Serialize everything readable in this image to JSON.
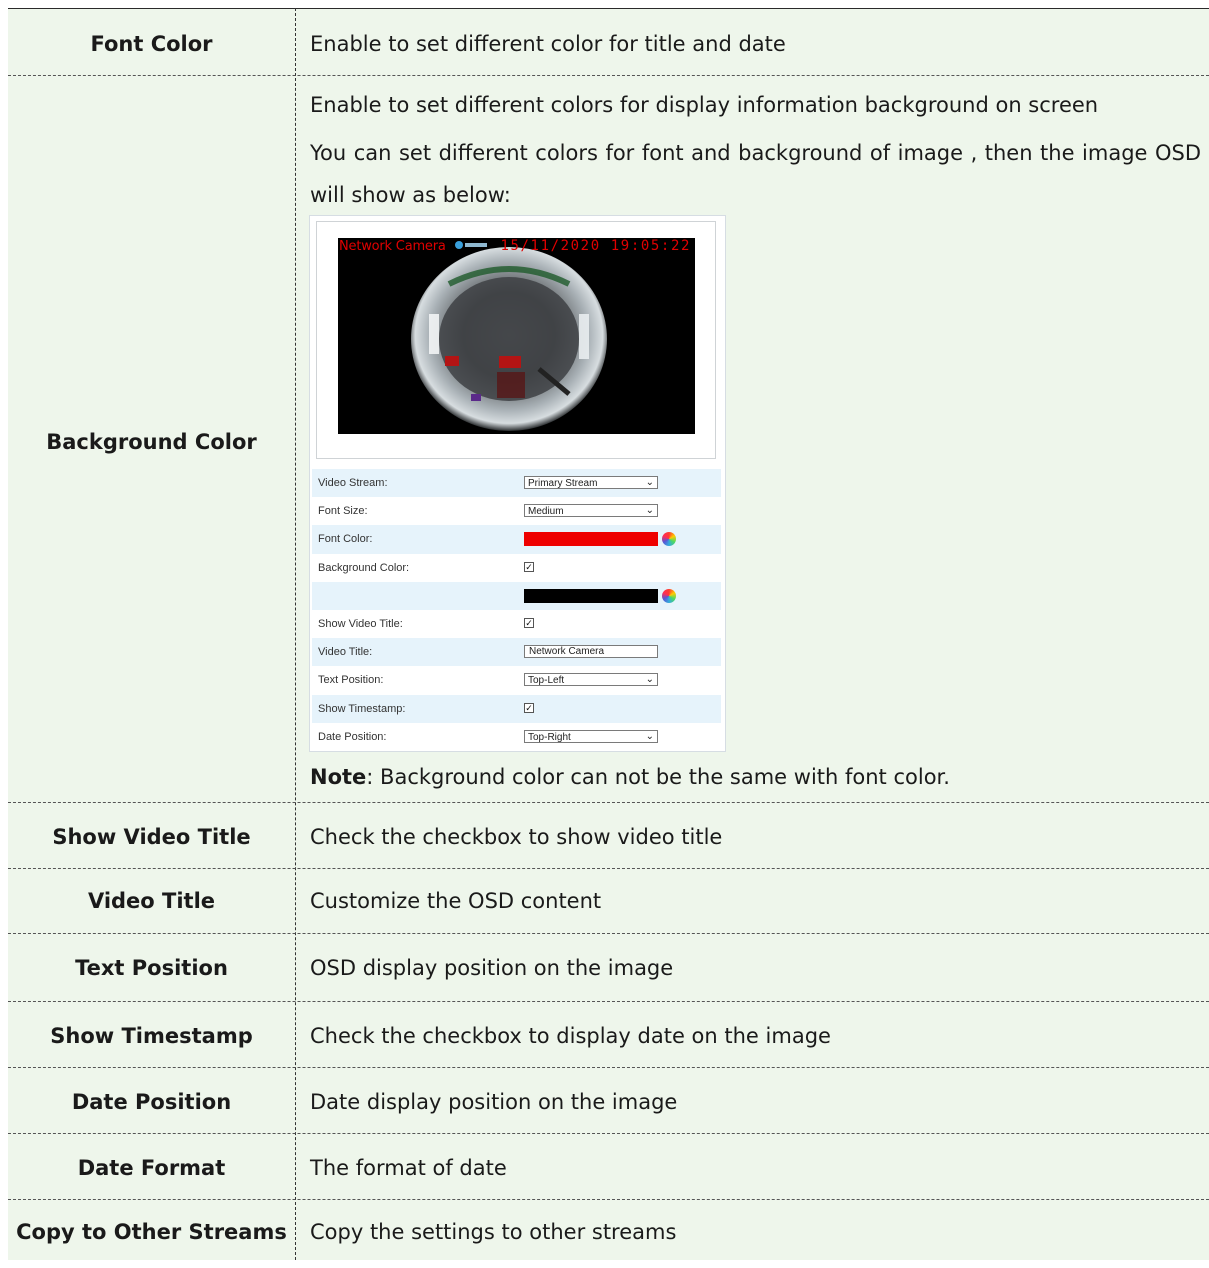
{
  "rows": [
    {
      "label": "Font Color",
      "desc": "Enable to set different color for title and date"
    },
    {
      "label": "Background Color",
      "desc_line1": "Enable to set different colors for display information background on screen",
      "desc_line2": "You can set different colors for font and background of image , then the image OSD will show as below:",
      "note_bold": "Note",
      "note_text": ": Background color can not be the same with font color."
    },
    {
      "label": "Show Video Title",
      "desc": "Check the checkbox to show video title"
    },
    {
      "label": "Video Title",
      "desc": "Customize the OSD content"
    },
    {
      "label": "Text Position",
      "desc": "OSD display position on the image"
    },
    {
      "label": "Show Timestamp",
      "desc": "Check the checkbox to display date on the image"
    },
    {
      "label": "Date Position",
      "desc": "Date display position on the image"
    },
    {
      "label": "Date Format",
      "desc": "The format of date"
    },
    {
      "label": "Copy to Other Streams",
      "desc": "Copy the settings to other streams"
    }
  ],
  "screenshot": {
    "osd_title": "Network Camera",
    "osd_date": "15/11/2020  19:05:22",
    "font_color": "#ee0000",
    "background_color": "#000000",
    "form": {
      "video_stream_label": "Video Stream:",
      "video_stream_value": "Primary Stream",
      "font_size_label": "Font Size:",
      "font_size_value": "Medium",
      "font_color_label": "Font Color:",
      "background_color_label": "Background Color:",
      "show_video_title_label": "Show Video Title:",
      "video_title_label": "Video Title:",
      "video_title_value": "Network Camera",
      "text_position_label": "Text Position:",
      "text_position_value": "Top-Left",
      "show_timestamp_label": "Show Timestamp:",
      "date_position_label": "Date Position:",
      "date_position_value": "Top-Right",
      "checkbox_mark": "✓",
      "chevron": "⌄"
    }
  }
}
